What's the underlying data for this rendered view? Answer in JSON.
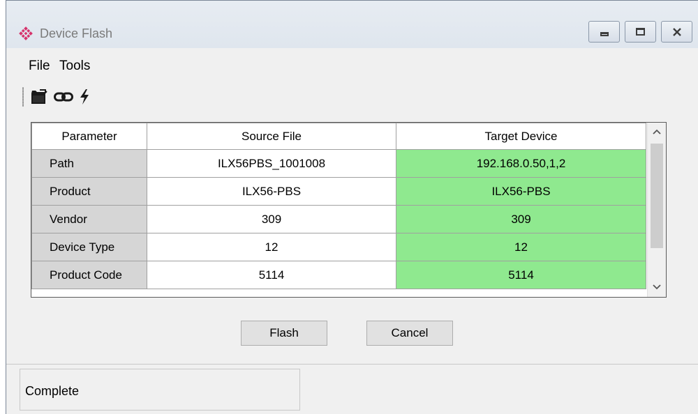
{
  "window": {
    "title": "Device Flash"
  },
  "menu": {
    "items": [
      "File",
      "Tools"
    ]
  },
  "toolbar": {
    "icons": [
      "open-folder-icon",
      "link-icon",
      "lightning-icon"
    ]
  },
  "grid": {
    "columns": [
      "Parameter",
      "Source File",
      "Target Device"
    ],
    "rows": [
      {
        "parameter": "Path",
        "source": "ILX56PBS_1001008",
        "target": "192.168.0.50,1,2"
      },
      {
        "parameter": "Product",
        "source": "ILX56-PBS",
        "target": "ILX56-PBS"
      },
      {
        "parameter": "Vendor",
        "source": "309",
        "target": "309"
      },
      {
        "parameter": "Device Type",
        "source": "12",
        "target": "12"
      },
      {
        "parameter": "Product Code",
        "source": "5114",
        "target": "5114"
      }
    ]
  },
  "buttons": {
    "flash": "Flash",
    "cancel": "Cancel"
  },
  "status": {
    "text": "Complete"
  },
  "colors": {
    "match": "#8fe98f",
    "parameter_bg": "#d6d6d6",
    "accent": "#d6336c"
  }
}
